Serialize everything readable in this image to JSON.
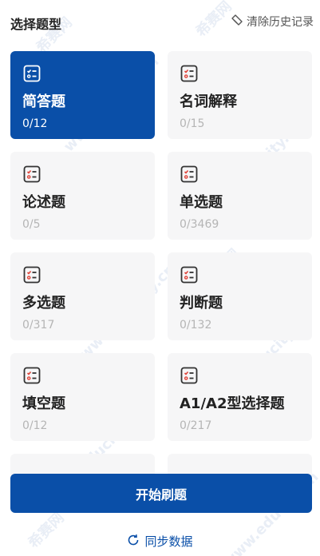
{
  "header": {
    "title": "选择题型",
    "clear_history_label": "清除历史记录",
    "clear_history_icon": "eraser-icon"
  },
  "cards": [
    {
      "name": "简答题",
      "count": "0/12",
      "active": true
    },
    {
      "name": "名词解释",
      "count": "0/15",
      "active": false
    },
    {
      "name": "论述题",
      "count": "0/5",
      "active": false
    },
    {
      "name": "单选题",
      "count": "0/3469",
      "active": false
    },
    {
      "name": "多选题",
      "count": "0/317",
      "active": false
    },
    {
      "name": "判断题",
      "count": "0/132",
      "active": false
    },
    {
      "name": "填空题",
      "count": "0/12",
      "active": false
    },
    {
      "name": "A1/A2型选择题",
      "count": "0/217",
      "active": false
    }
  ],
  "start_button_label": "开始刷题",
  "sync_label": "同步数据",
  "watermark": {
    "text_cn": "希赛网",
    "text_en": "www.educity.cn"
  },
  "colors": {
    "accent": "#0a4fa8",
    "card_bg": "#f6f6f7",
    "count_text": "#b5b5b5",
    "icon_red": "#e0443a"
  }
}
